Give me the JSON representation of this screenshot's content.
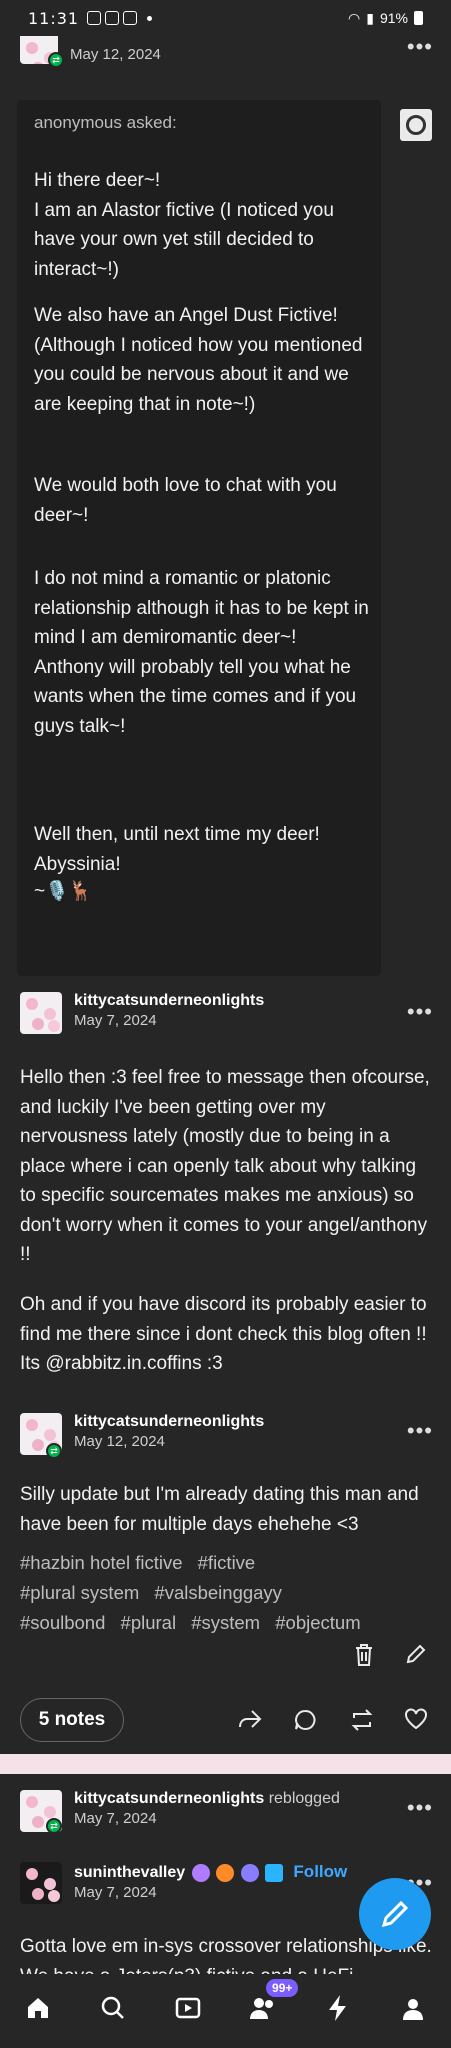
{
  "status_bar": {
    "time": "11:31",
    "battery": "91%"
  },
  "top_post": {
    "date": "May 12, 2024"
  },
  "ask": {
    "asker": "anonymous asked:",
    "paragraphs": [
      "Hi there deer~!\nI am an Alastor fictive (I noticed you have your own yet still decided to interact~!)",
      "We also have an Angel Dust Fictive! (Although I noticed how you mentioned you could be nervous about it and we are keeping that in note~!)",
      "We would both love to chat with you deer~!",
      "I do not mind a romantic or platonic relationship although it has to be kept in mind I am demiromantic deer~!\nAnthony will probably tell you what he wants when the time comes and if you guys talk~!",
      "Well then, until next time my deer!\nAbyssinia!",
      "~🎙️🦌"
    ]
  },
  "answer": {
    "username": "kittycatsunderneonlights",
    "date": "May 7, 2024",
    "paragraphs": [
      "Hello then :3 feel free to message then ofcourse, and luckily I've been getting over my nervousness lately (mostly due to being in a place where i can openly talk about why talking to specific sourcemates makes me anxious) so don't worry when it comes to your angel/anthony !!",
      "Oh and if you have discord its probably easier to find me there since i dont check this blog often !! Its @rabbitz.in.coffins :3"
    ]
  },
  "update": {
    "username": "kittycatsunderneonlights",
    "date": "May 12, 2024",
    "text": "Silly update but I'm already dating this man and have been for multiple days ehehehe <3",
    "tags": [
      "#hazbin hotel fictive",
      "#fictive",
      "#plural system",
      "#valsbeinggayy",
      "#soulbond",
      "#plural",
      "#system",
      "#objectum"
    ]
  },
  "actions": {
    "notes": "5 notes"
  },
  "next_post": {
    "username": "kittycatsunderneonlights",
    "reblogged_label": "reblogged",
    "date": "May 7, 2024",
    "inner_username": "suninthevalley",
    "inner_date": "May 7, 2024",
    "follow_label": "Follow",
    "text_partial": "Gotta love em in-sys crossover relationships like. We have a Jeters(p3) fictive and a HeFi"
  },
  "tab_bar": {
    "activity_badge": "99+"
  },
  "colors": {
    "background": "#121212",
    "card": "#262626",
    "ask_box": "#1e1e1e",
    "accent": "#1e9bf0",
    "reblog_green": "#00b34a",
    "badge_purple": "#7d5cff"
  }
}
